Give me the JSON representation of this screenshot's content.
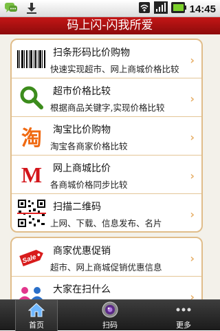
{
  "status": {
    "time": "14:45"
  },
  "app": {
    "title": "码上闪-闪我所爱"
  },
  "menu": [
    {
      "title": "扫条形码比价购物",
      "desc": "快速实现超市、网上商城价格比较",
      "icon": "barcode-icon"
    },
    {
      "title": "超市价格比较",
      "desc": "根据商品关键字,实现价格比较",
      "icon": "search-icon"
    },
    {
      "title": "淘宝比价购物",
      "desc": "淘宝各商家价格比较",
      "icon": "taobao-icon",
      "icon_text": "淘"
    },
    {
      "title": "网上商城比价",
      "desc": "各商城价格同步比较",
      "icon": "mall-icon",
      "icon_text": "M"
    },
    {
      "title": "扫描二维码",
      "desc": "上网、下载、信息发布、名片",
      "icon": "qr-code-icon"
    }
  ],
  "menu2": [
    {
      "title": "商家优惠促销",
      "desc": "超市、网上商城促销优惠信息",
      "icon": "sale-tag-icon",
      "icon_text": "Sale"
    },
    {
      "title": "大家在扫什么",
      "desc": "",
      "icon": "people-icon"
    }
  ],
  "tabs": [
    {
      "label": "首页",
      "icon": "home-icon"
    },
    {
      "label": "扫码",
      "icon": "camera-icon"
    },
    {
      "label": "更多",
      "icon": "more-icon"
    }
  ],
  "colors": {
    "title_bar": "#b01212",
    "card_border": "#e0bd8a",
    "chevron": "#e7b06a"
  }
}
